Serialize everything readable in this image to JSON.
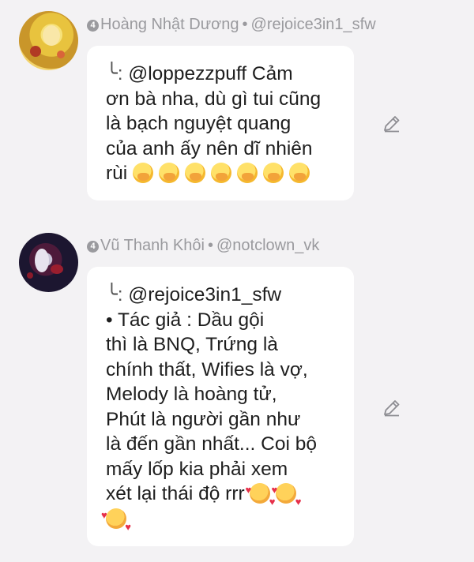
{
  "comments": [
    {
      "author": "Hoàng Nhật Dương",
      "badge": "4",
      "handle": "@rejoice3in1_sfw",
      "reply_marker": "╰:",
      "lines": [
        " @loppezzpuff Cảm",
        "ơn bà nha, dù gì tui cũng",
        "là bạch nguyệt quang",
        "của anh ấy nên dĩ nhiên",
        "rùi "
      ],
      "emojis": [
        "hand-over-mouth-emoji",
        "hand-over-mouth-emoji",
        "hand-over-mouth-emoji",
        "hand-over-mouth-emoji",
        "hand-over-mouth-emoji",
        "hand-over-mouth-emoji",
        "hand-over-mouth-emoji"
      ]
    },
    {
      "author": "Vũ Thanh Khôi",
      "badge": "4",
      "handle": "@notclown_vk",
      "reply_marker": "╰:",
      "lines": [
        " @rejoice3in1_sfw",
        "• Tác giả : Dầu gội",
        "thì là BNQ, Trứng là",
        "chính thất, Wifies là vợ,",
        "Melody là hoàng tử,",
        "Phút là người gần như",
        "là đến gần nhất... Coi bộ",
        "mấy lốp kia phải xem",
        "xét lại thái độ rrr "
      ],
      "emojis": [
        "smiling-face-with-hearts-emoji",
        "smiling-face-with-hearts-emoji",
        "smiling-face-with-hearts-emoji"
      ]
    }
  ],
  "colors": {
    "background": "#f3f2f4",
    "bubble": "#ffffff",
    "meta_text": "#9a9a9e",
    "body_text": "#1e1e1e"
  }
}
